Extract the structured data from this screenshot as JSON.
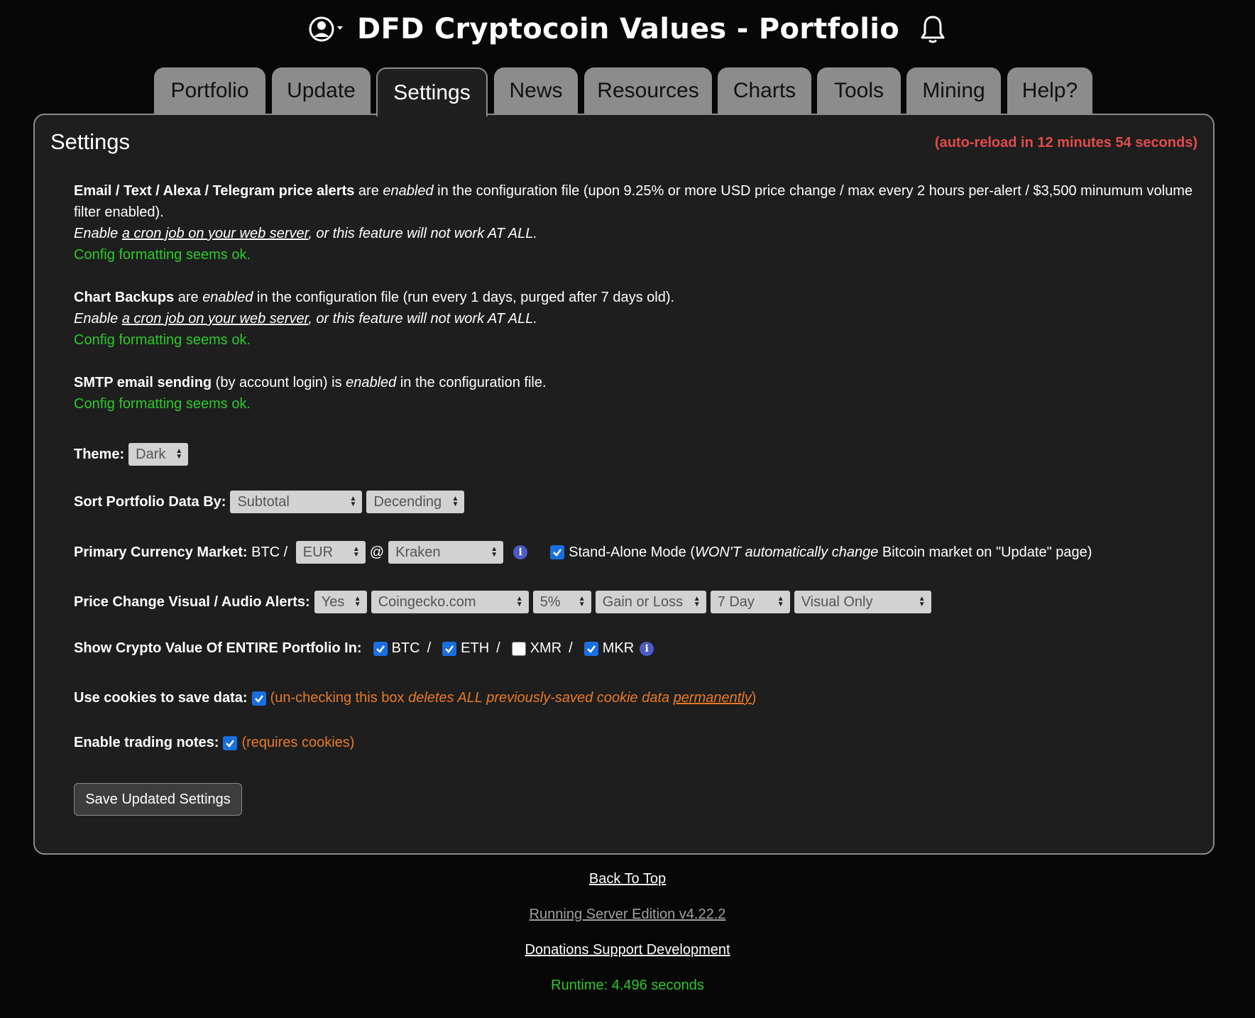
{
  "header": {
    "title": "DFD Cryptocoin Values - Portfolio"
  },
  "tabs": [
    {
      "label": "Portfolio"
    },
    {
      "label": "Update"
    },
    {
      "label": "Settings"
    },
    {
      "label": "News"
    },
    {
      "label": "Resources"
    },
    {
      "label": "Charts"
    },
    {
      "label": "Tools"
    },
    {
      "label": "Mining"
    },
    {
      "label": "Help?"
    }
  ],
  "active_tab": "Settings",
  "panel": {
    "title": "Settings",
    "autoreload": "(auto-reload in 12 minutes 54 seconds)"
  },
  "alerts_section": {
    "title": "Email / Text / Alexa / Telegram price alerts",
    "are": " are ",
    "enabled": "enabled",
    "rest": " in the configuration file (upon 9.25% or more USD price change / max every 2 hours per-alert / $3,500 minumum volume filter enabled).",
    "enable": "Enable ",
    "cron_link": "a cron job on your web server",
    "cron_rest": ", or this feature will not work AT ALL.",
    "ok": "Config formatting seems ok."
  },
  "backups_section": {
    "title": "Chart Backups",
    "are": " are ",
    "enabled": "enabled",
    "rest": " in the configuration file (run every 1 days, purged after 7 days old).",
    "enable": "Enable ",
    "cron_link": "a cron job on your web server",
    "cron_rest": ", or this feature will not work AT ALL.",
    "ok": "Config formatting seems ok."
  },
  "smtp_section": {
    "title": "SMTP email sending",
    "mid": " (by account login) is ",
    "enabled": "enabled",
    "rest": " in the configuration file.",
    "ok": "Config formatting seems ok."
  },
  "theme": {
    "label": "Theme:",
    "value": "Dark"
  },
  "sort": {
    "label": "Sort Portfolio Data By:",
    "field": "Subtotal",
    "order": "Decending"
  },
  "primary_market": {
    "label": "Primary Currency Market:",
    "prefix": " BTC / ",
    "currency": "EUR",
    "at": "@",
    "exchange": "Kraken",
    "standalone_text_1": "Stand-Alone Mode (",
    "standalone_em": "WON'T automatically change",
    "standalone_text_2": " Bitcoin market on \"Update\" page)"
  },
  "price_alerts": {
    "label": "Price Change Visual / Audio Alerts:",
    "enabled": "Yes",
    "source": "Coingecko.com",
    "percent": "5%",
    "direction": "Gain or Loss",
    "period": "7 Day",
    "mode": "Visual Only"
  },
  "crypto_value": {
    "label": "Show Crypto Value Of ENTIRE Portfolio In:",
    "coins": [
      {
        "name": "BTC",
        "checked": true
      },
      {
        "name": "ETH",
        "checked": true
      },
      {
        "name": "XMR",
        "checked": false
      },
      {
        "name": "MKR",
        "checked": true
      }
    ],
    "separator": "/"
  },
  "cookies": {
    "label": "Use cookies to save data:",
    "note_1": "(un-checking this box ",
    "note_em": "deletes ALL previously-saved cookie data ",
    "note_link": "permanently",
    "note_2": ")"
  },
  "trading_notes": {
    "label": "Enable trading notes:",
    "note": "(requires cookies)"
  },
  "save_button": "Save Updated Settings",
  "footer": {
    "back_to_top": "Back To Top",
    "edition": "Running Server Edition v4.22.2",
    "donations": "Donations Support Development",
    "runtime": "Runtime: 4.496 seconds"
  },
  "colors": {
    "ok_green": "#2cc92c",
    "alert_red": "#e24b4b",
    "note_orange": "#e87a25",
    "checkbox_blue": "#1a6fe0",
    "info_blue": "#4b5bc8"
  }
}
